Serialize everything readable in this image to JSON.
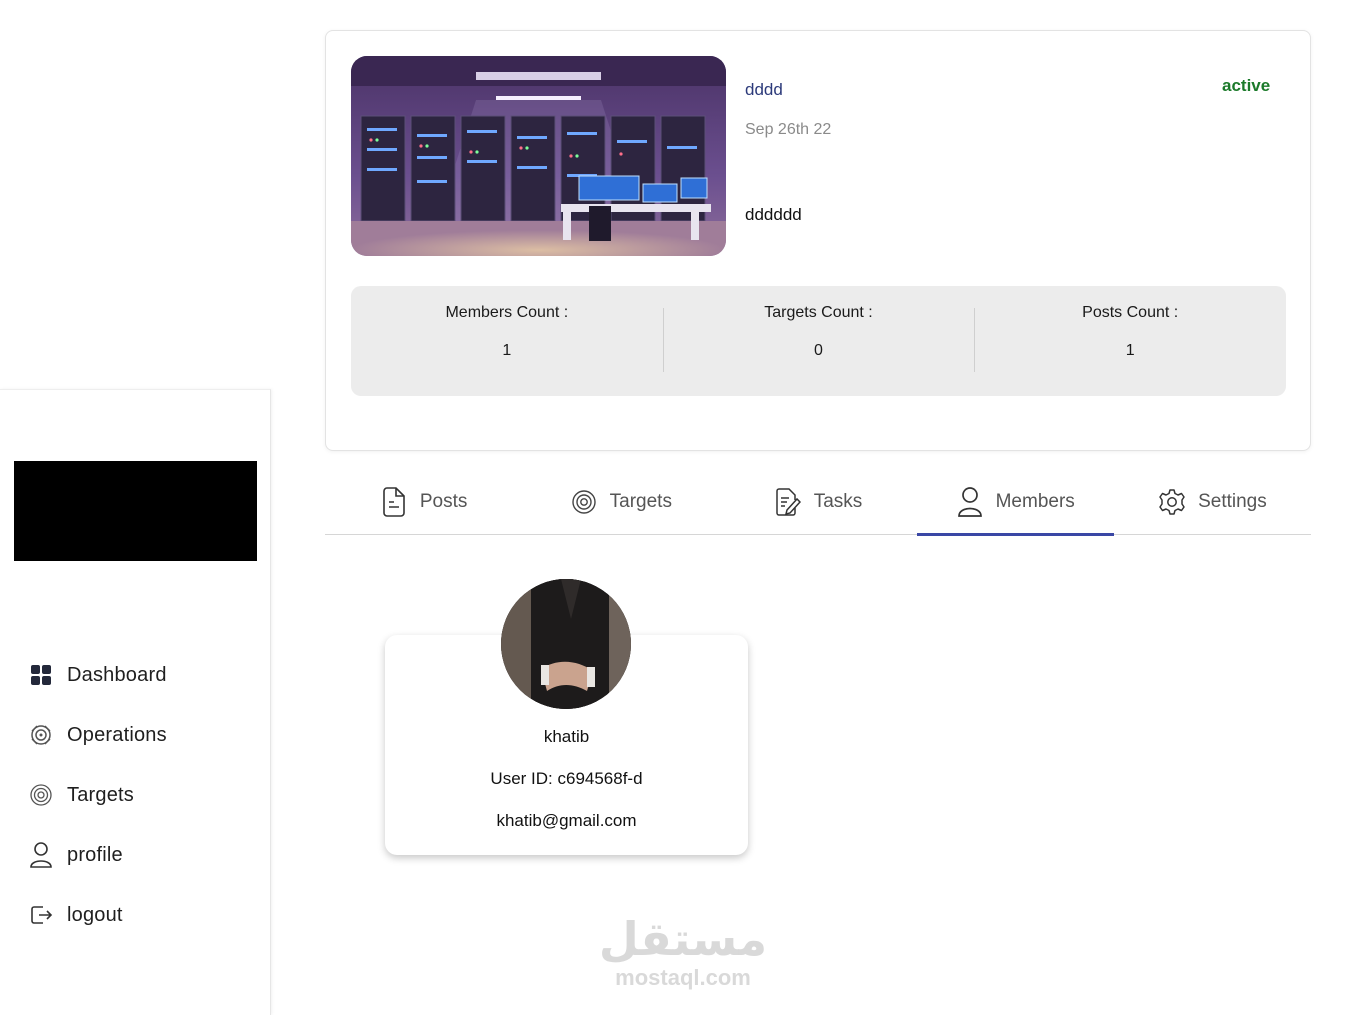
{
  "sidebar": {
    "items": [
      {
        "label": "Dashboard",
        "icon": "dashboard-grid-icon"
      },
      {
        "label": "Operations",
        "icon": "operations-icon"
      },
      {
        "label": "Targets",
        "icon": "target-icon"
      },
      {
        "label": "profile",
        "icon": "user-icon"
      },
      {
        "label": "logout",
        "icon": "logout-icon"
      }
    ]
  },
  "operation": {
    "name": "dddd",
    "date": "Sep 26th 22",
    "description": "dddddd",
    "status": "active",
    "status_color": "#1b7a2a"
  },
  "stats": [
    {
      "label": "Members Count :",
      "value": "1"
    },
    {
      "label": "Targets Count :",
      "value": "0"
    },
    {
      "label": "Posts Count :",
      "value": "1"
    }
  ],
  "tabs": [
    {
      "label": "Posts",
      "icon": "document-icon"
    },
    {
      "label": "Targets",
      "icon": "target-icon"
    },
    {
      "label": "Tasks",
      "icon": "tasks-icon"
    },
    {
      "label": "Members",
      "icon": "user-icon",
      "active": true
    },
    {
      "label": "Settings",
      "icon": "gear-icon"
    }
  ],
  "member": {
    "name": "khatib",
    "user_id": "User ID:  c694568f-d",
    "email": "khatib@gmail.com"
  },
  "watermark": {
    "arabic": "مستقل",
    "latin": "mostaql.com"
  },
  "colors": {
    "accent": "#3a47a5",
    "stats_bg": "#ececec"
  }
}
